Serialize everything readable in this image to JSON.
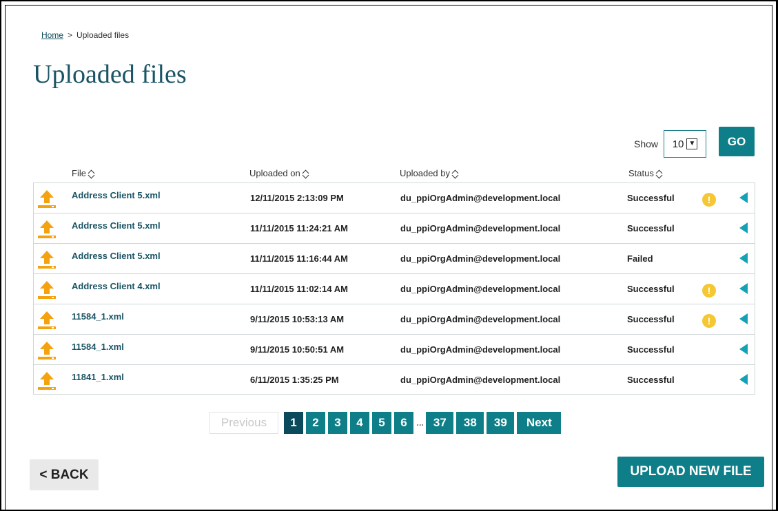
{
  "breadcrumb": {
    "home": "Home",
    "separator": ">",
    "current": "Uploaded files"
  },
  "title": "Uploaded files",
  "controls": {
    "show_label": "Show",
    "page_size": "10",
    "go_label": "GO"
  },
  "columns": {
    "file": "File",
    "uploaded_on": "Uploaded on",
    "uploaded_by": "Uploaded by",
    "status": "Status"
  },
  "rows": [
    {
      "file": "Address Client 5.xml",
      "uploaded_on": "12/11/2015 2:13:09 PM",
      "uploaded_by": "du_ppiOrgAdmin@development.local",
      "status": "Successful",
      "warning": "!"
    },
    {
      "file": "Address Client 5.xml",
      "uploaded_on": "11/11/2015 11:24:21 AM",
      "uploaded_by": "du_ppiOrgAdmin@development.local",
      "status": "Successful",
      "warning": ""
    },
    {
      "file": "Address Client 5.xml",
      "uploaded_on": "11/11/2015 11:16:44 AM",
      "uploaded_by": "du_ppiOrgAdmin@development.local",
      "status": "Failed",
      "warning": ""
    },
    {
      "file": "Address Client 4.xml",
      "uploaded_on": "11/11/2015 11:02:14 AM",
      "uploaded_by": "du_ppiOrgAdmin@development.local",
      "status": "Successful",
      "warning": "!"
    },
    {
      "file": "11584_1.xml",
      "uploaded_on": "9/11/2015 10:53:13 AM",
      "uploaded_by": "du_ppiOrgAdmin@development.local",
      "status": "Successful",
      "warning": "!"
    },
    {
      "file": "11584_1.xml",
      "uploaded_on": "9/11/2015 10:50:51 AM",
      "uploaded_by": "du_ppiOrgAdmin@development.local",
      "status": "Successful",
      "warning": ""
    },
    {
      "file": "11841_1.xml",
      "uploaded_on": "6/11/2015 1:35:25 PM",
      "uploaded_by": "du_ppiOrgAdmin@development.local",
      "status": "Successful",
      "warning": ""
    }
  ],
  "pagination": {
    "previous": "Previous",
    "pages": [
      "1",
      "2",
      "3",
      "4",
      "5",
      "6"
    ],
    "ellipsis": "...",
    "last_pages": [
      "37",
      "38",
      "39"
    ],
    "next": "Next",
    "current": "1"
  },
  "actions": {
    "back": "< BACK",
    "upload": "UPLOAD NEW FILE"
  },
  "colors": {
    "accent": "#0e7f88",
    "title": "#1a5465",
    "icon_orange": "#f4a20f",
    "warning_yellow": "#f5c733",
    "expand_arrow": "#13a1b6"
  },
  "icons": {
    "file_row": "upload-arrow-icon",
    "warning": "warning-icon",
    "expand": "expand-left-icon",
    "sort": "sort-icon"
  }
}
